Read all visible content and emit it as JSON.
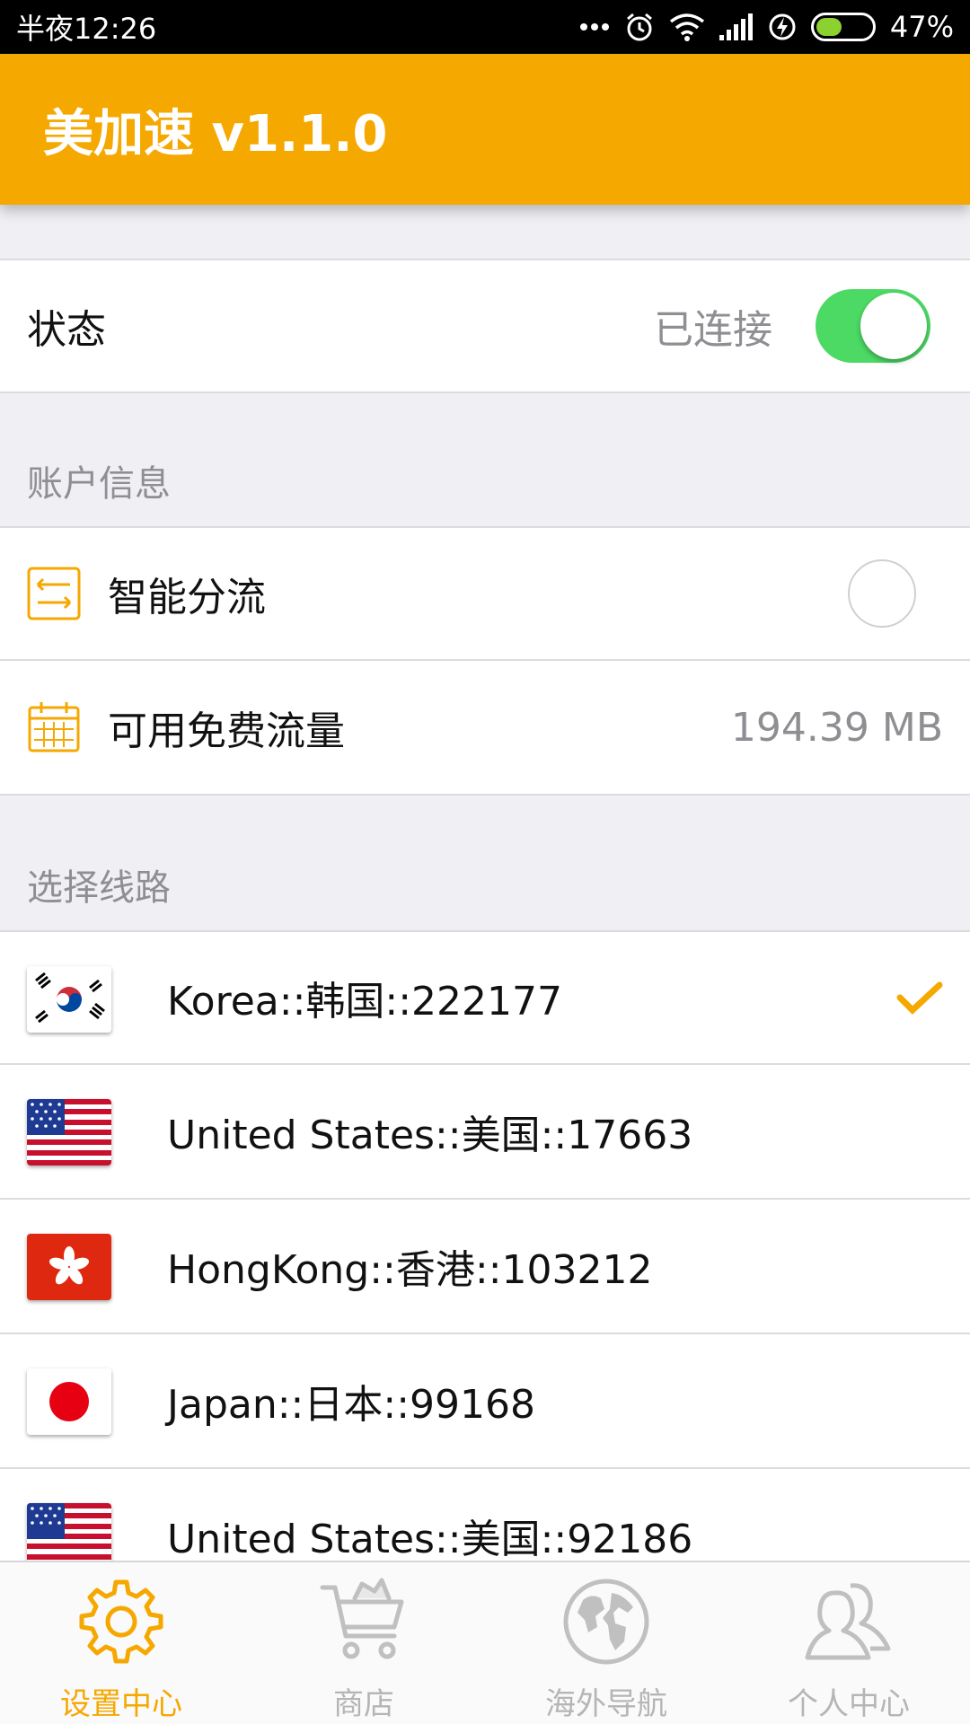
{
  "status_bar": {
    "time": "半夜12:26",
    "battery": "47%",
    "battery_level": 0.47
  },
  "app_bar": {
    "title": "美加速 v1.1.0"
  },
  "state_row": {
    "label": "状态",
    "value": "已连接",
    "toggle_on": true
  },
  "account_section": {
    "header": "账户信息",
    "smart_split": {
      "label": "智能分流",
      "icon": "arrows-exchange-icon"
    },
    "free_traffic": {
      "label": "可用免费流量",
      "value": "194.39 MB",
      "icon": "calendar-icon"
    }
  },
  "routes_section": {
    "header": "选择线路",
    "routes": [
      {
        "label": "Korea::韩国::222177",
        "flag": "korea-flag-icon",
        "selected": true
      },
      {
        "label": "United States::美国::17663",
        "flag": "usa-flag-icon",
        "selected": false
      },
      {
        "label": "HongKong::香港::103212",
        "flag": "hongkong-flag-icon",
        "selected": false
      },
      {
        "label": "Japan::日本::99168",
        "flag": "japan-flag-icon",
        "selected": false
      },
      {
        "label": "United States::美国::92186",
        "flag": "usa-flag-icon",
        "selected": false
      }
    ]
  },
  "tab_bar": {
    "tabs": [
      {
        "label": "设置中心",
        "icon": "gear-icon",
        "active": true
      },
      {
        "label": "商店",
        "icon": "cart-icon",
        "active": false
      },
      {
        "label": "海外导航",
        "icon": "globe-icon",
        "active": false
      },
      {
        "label": "个人中心",
        "icon": "users-icon",
        "active": false
      }
    ]
  },
  "colors": {
    "accent": "#f5a800",
    "toggle_on": "#4cd964",
    "background": "#efeff4"
  }
}
